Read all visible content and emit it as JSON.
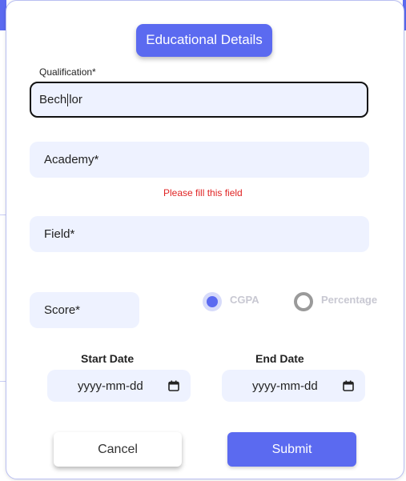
{
  "title": "Educational Details",
  "qualification": {
    "caption": "Qualification*",
    "value_before_caret": "Bech",
    "value_after_caret": "lor"
  },
  "academy": {
    "placeholder": "Academy*",
    "error": "Please fill this field"
  },
  "field": {
    "placeholder": "Field*"
  },
  "score": {
    "placeholder": "Score*",
    "options": [
      {
        "label": "CGPA",
        "checked": true
      },
      {
        "label": "Percentage",
        "checked": false
      }
    ]
  },
  "dates": {
    "start_label": "Start Date",
    "end_label": "End Date",
    "start_value": "yyyy-mm-dd",
    "end_value": "yyyy-mm-dd"
  },
  "buttons": {
    "cancel": "Cancel",
    "submit": "Submit"
  },
  "colors": {
    "accent": "#5b6af0",
    "input_bg": "#eef2ff",
    "error": "#e02424"
  },
  "icons": {
    "date": "calendar-icon"
  }
}
